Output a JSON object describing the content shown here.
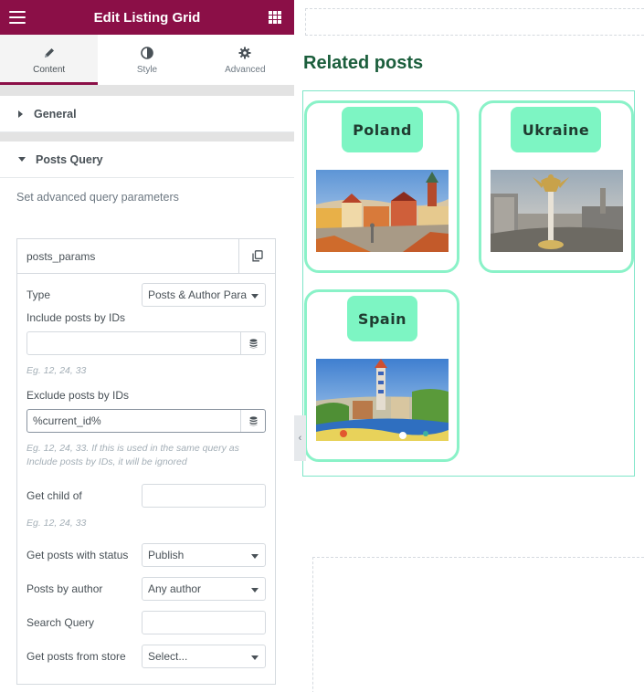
{
  "header": {
    "title": "Edit Listing Grid"
  },
  "tabs": [
    {
      "label": "Content",
      "icon": "pencil-icon"
    },
    {
      "label": "Style",
      "icon": "contrast-icon"
    },
    {
      "label": "Advanced",
      "icon": "gear-icon"
    }
  ],
  "sections": {
    "general": "General",
    "posts_query": "Posts Query"
  },
  "posts_query": {
    "description": "Set advanced query parameters",
    "repeater_title": "posts_params",
    "type_label": "Type",
    "type_value": "Posts & Author Parameters",
    "include_label": "Include posts by IDs",
    "include_value": "",
    "include_hint": "Eg. 12, 24, 33",
    "exclude_label": "Exclude posts by IDs",
    "exclude_value": "%current_id%",
    "exclude_hint": "Eg. 12, 24, 33. If this is used in the same query as Include posts by IDs, it will be ignored",
    "child_label": "Get child of",
    "child_value": "",
    "child_hint": "Eg. 12, 24, 33",
    "status_label": "Get posts with status",
    "status_value": "Publish",
    "author_label": "Posts by author",
    "author_value": "Any author",
    "search_label": "Search Query",
    "search_value": "",
    "store_label": "Get posts from store",
    "store_value": "Select..."
  },
  "preview": {
    "title": "Related posts",
    "cards": [
      {
        "label": "Poland"
      },
      {
        "label": "Ukraine"
      },
      {
        "label": "Spain"
      }
    ]
  },
  "colors": {
    "brand": "#8b0f47",
    "tag_bg": "#7df5c3",
    "card_border": "#8af2c8",
    "title": "#1b5e3c"
  }
}
